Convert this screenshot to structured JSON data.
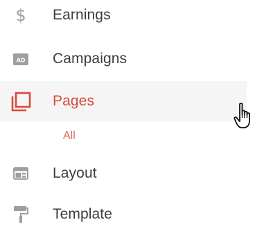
{
  "sidebar": {
    "items": [
      {
        "label": "Earnings",
        "icon": "dollar-icon"
      },
      {
        "label": "Campaigns",
        "icon": "ad-icon",
        "icon_text": "AD"
      },
      {
        "label": "Pages",
        "icon": "pages-icon",
        "active": true
      },
      {
        "label": "Layout",
        "icon": "layout-icon"
      },
      {
        "label": "Template",
        "icon": "paint-roller-icon"
      }
    ],
    "pages_subitems": [
      {
        "label": "All"
      }
    ]
  },
  "colors": {
    "active_accent": "#d9493b",
    "subitem": "#e06a5a",
    "text": "#3c3c3c",
    "icon_gray": "#9e9e9e",
    "active_background": "#f5f5f5"
  }
}
